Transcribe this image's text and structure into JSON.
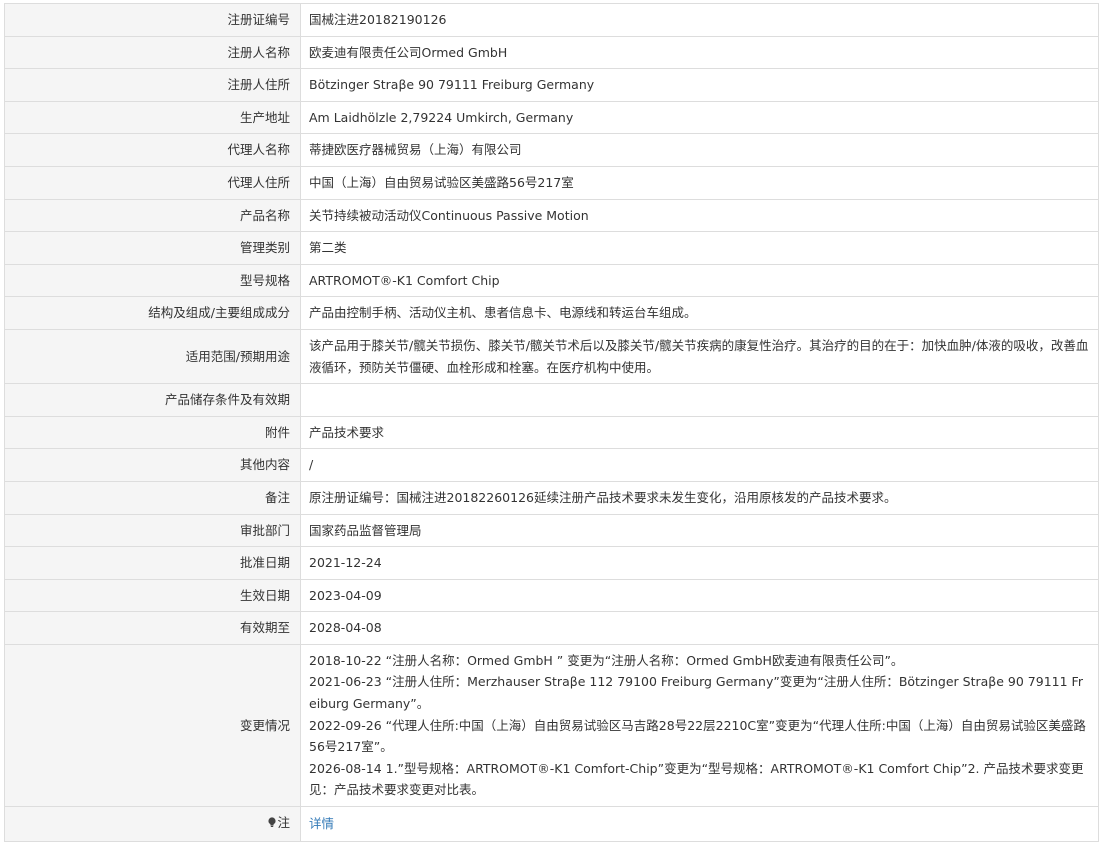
{
  "rows": [
    {
      "key": "reg_no",
      "label": "注册证编号",
      "value": "国械注进20182190126"
    },
    {
      "key": "registrant_name",
      "label": "注册人名称",
      "value": "欧麦迪有限责任公司Ormed GmbH"
    },
    {
      "key": "registrant_address",
      "label": "注册人住所",
      "value": "Bötzinger Straβe 90 79111 Freiburg Germany"
    },
    {
      "key": "production_address",
      "label": "生产地址",
      "value": "Am Laidhölzle 2,79224 Umkirch, Germany"
    },
    {
      "key": "agent_name",
      "label": "代理人名称",
      "value": "蒂捷欧医疗器械贸易（上海）有限公司"
    },
    {
      "key": "agent_address",
      "label": "代理人住所",
      "value": "中国（上海）自由贸易试验区美盛路56号217室"
    },
    {
      "key": "product_name",
      "label": "产品名称",
      "value": "关节持续被动活动仪Continuous Passive Motion"
    },
    {
      "key": "class",
      "label": "管理类别",
      "value": "第二类"
    },
    {
      "key": "model",
      "label": "型号规格",
      "value": "ARTROMOT®-K1 Comfort Chip"
    },
    {
      "key": "composition",
      "label": "结构及组成/主要组成成分",
      "value": "产品由控制手柄、活动仪主机、患者信息卡、电源线和转运台车组成。"
    },
    {
      "key": "intended_use",
      "label": "适用范围/预期用途",
      "value": "该产品用于膝关节/髋关节损伤、膝关节/髋关节术后以及膝关节/髋关节疾病的康复性治疗。其治疗的目的在于：加快血肿/体液的吸收，改善血液循环，预防关节僵硬、血栓形成和栓塞。在医疗机构中使用。"
    },
    {
      "key": "storage",
      "label": "产品储存条件及有效期",
      "value": ""
    },
    {
      "key": "attachment",
      "label": "附件",
      "value": "产品技术要求"
    },
    {
      "key": "other",
      "label": "其他内容",
      "value": "/"
    },
    {
      "key": "remark",
      "label": "备注",
      "value": "原注册证编号：国械注进20182260126延续注册产品技术要求未发生变化，沿用原核发的产品技术要求。"
    },
    {
      "key": "approval_dept",
      "label": "审批部门",
      "value": "国家药品监督管理局"
    },
    {
      "key": "approval_date",
      "label": "批准日期",
      "value": "2021-12-24"
    },
    {
      "key": "effective_date",
      "label": "生效日期",
      "value": "2023-04-09"
    },
    {
      "key": "expiry_date",
      "label": "有效期至",
      "value": "2028-04-08"
    }
  ],
  "changes": {
    "label": "变更情况",
    "lines": [
      "2018-10-22 “注册人名称：Ormed GmbH ” 变更为“注册人名称：Ormed GmbH欧麦迪有限责任公司”。",
      "2021-06-23 “注册人住所：Merzhauser Straβe 112 79100 Freiburg Germany”变更为“注册人住所：Bötzinger Straβe 90 79111 Freiburg Germany”。",
      "2022-09-26 “代理人住所:中国（上海）自由贸易试验区马吉路28号22层2210C室”变更为“代理人住所:中国（上海）自由贸易试验区美盛路56号217室”。",
      "2026-08-14 1.”型号规格：ARTROMOT®-K1 Comfort-Chip”变更为“型号规格：ARTROMOT®-K1 Comfort Chip”2. 产品技术要求变更见：产品技术要求变更对比表。"
    ]
  },
  "note": {
    "icon": "lightbulb-icon",
    "label": "注",
    "link_text": "详情",
    "link_color": "#337ab7"
  }
}
